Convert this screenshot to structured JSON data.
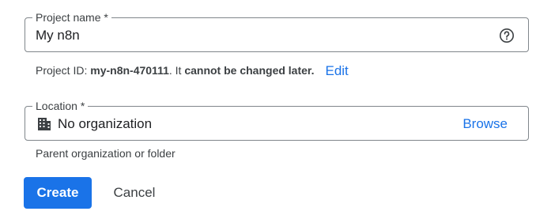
{
  "project_name": {
    "label": "Project name *",
    "value": "My n8n",
    "help_icon": "help-circle-icon"
  },
  "project_id_hint": {
    "prefix": "Project ID: ",
    "id": "my-n8n-470111",
    "middle": ". It ",
    "bold_tail": "cannot be changed later.",
    "edit_label": "Edit"
  },
  "location": {
    "label": "Location *",
    "value": "No organization",
    "icon": "building-icon",
    "browse_label": "Browse",
    "hint": "Parent organization or folder"
  },
  "actions": {
    "create_label": "Create",
    "cancel_label": "Cancel"
  },
  "colors": {
    "accent": "#1a73e8",
    "border": "#80868b",
    "text": "#202124",
    "secondary_text": "#3c4043"
  }
}
